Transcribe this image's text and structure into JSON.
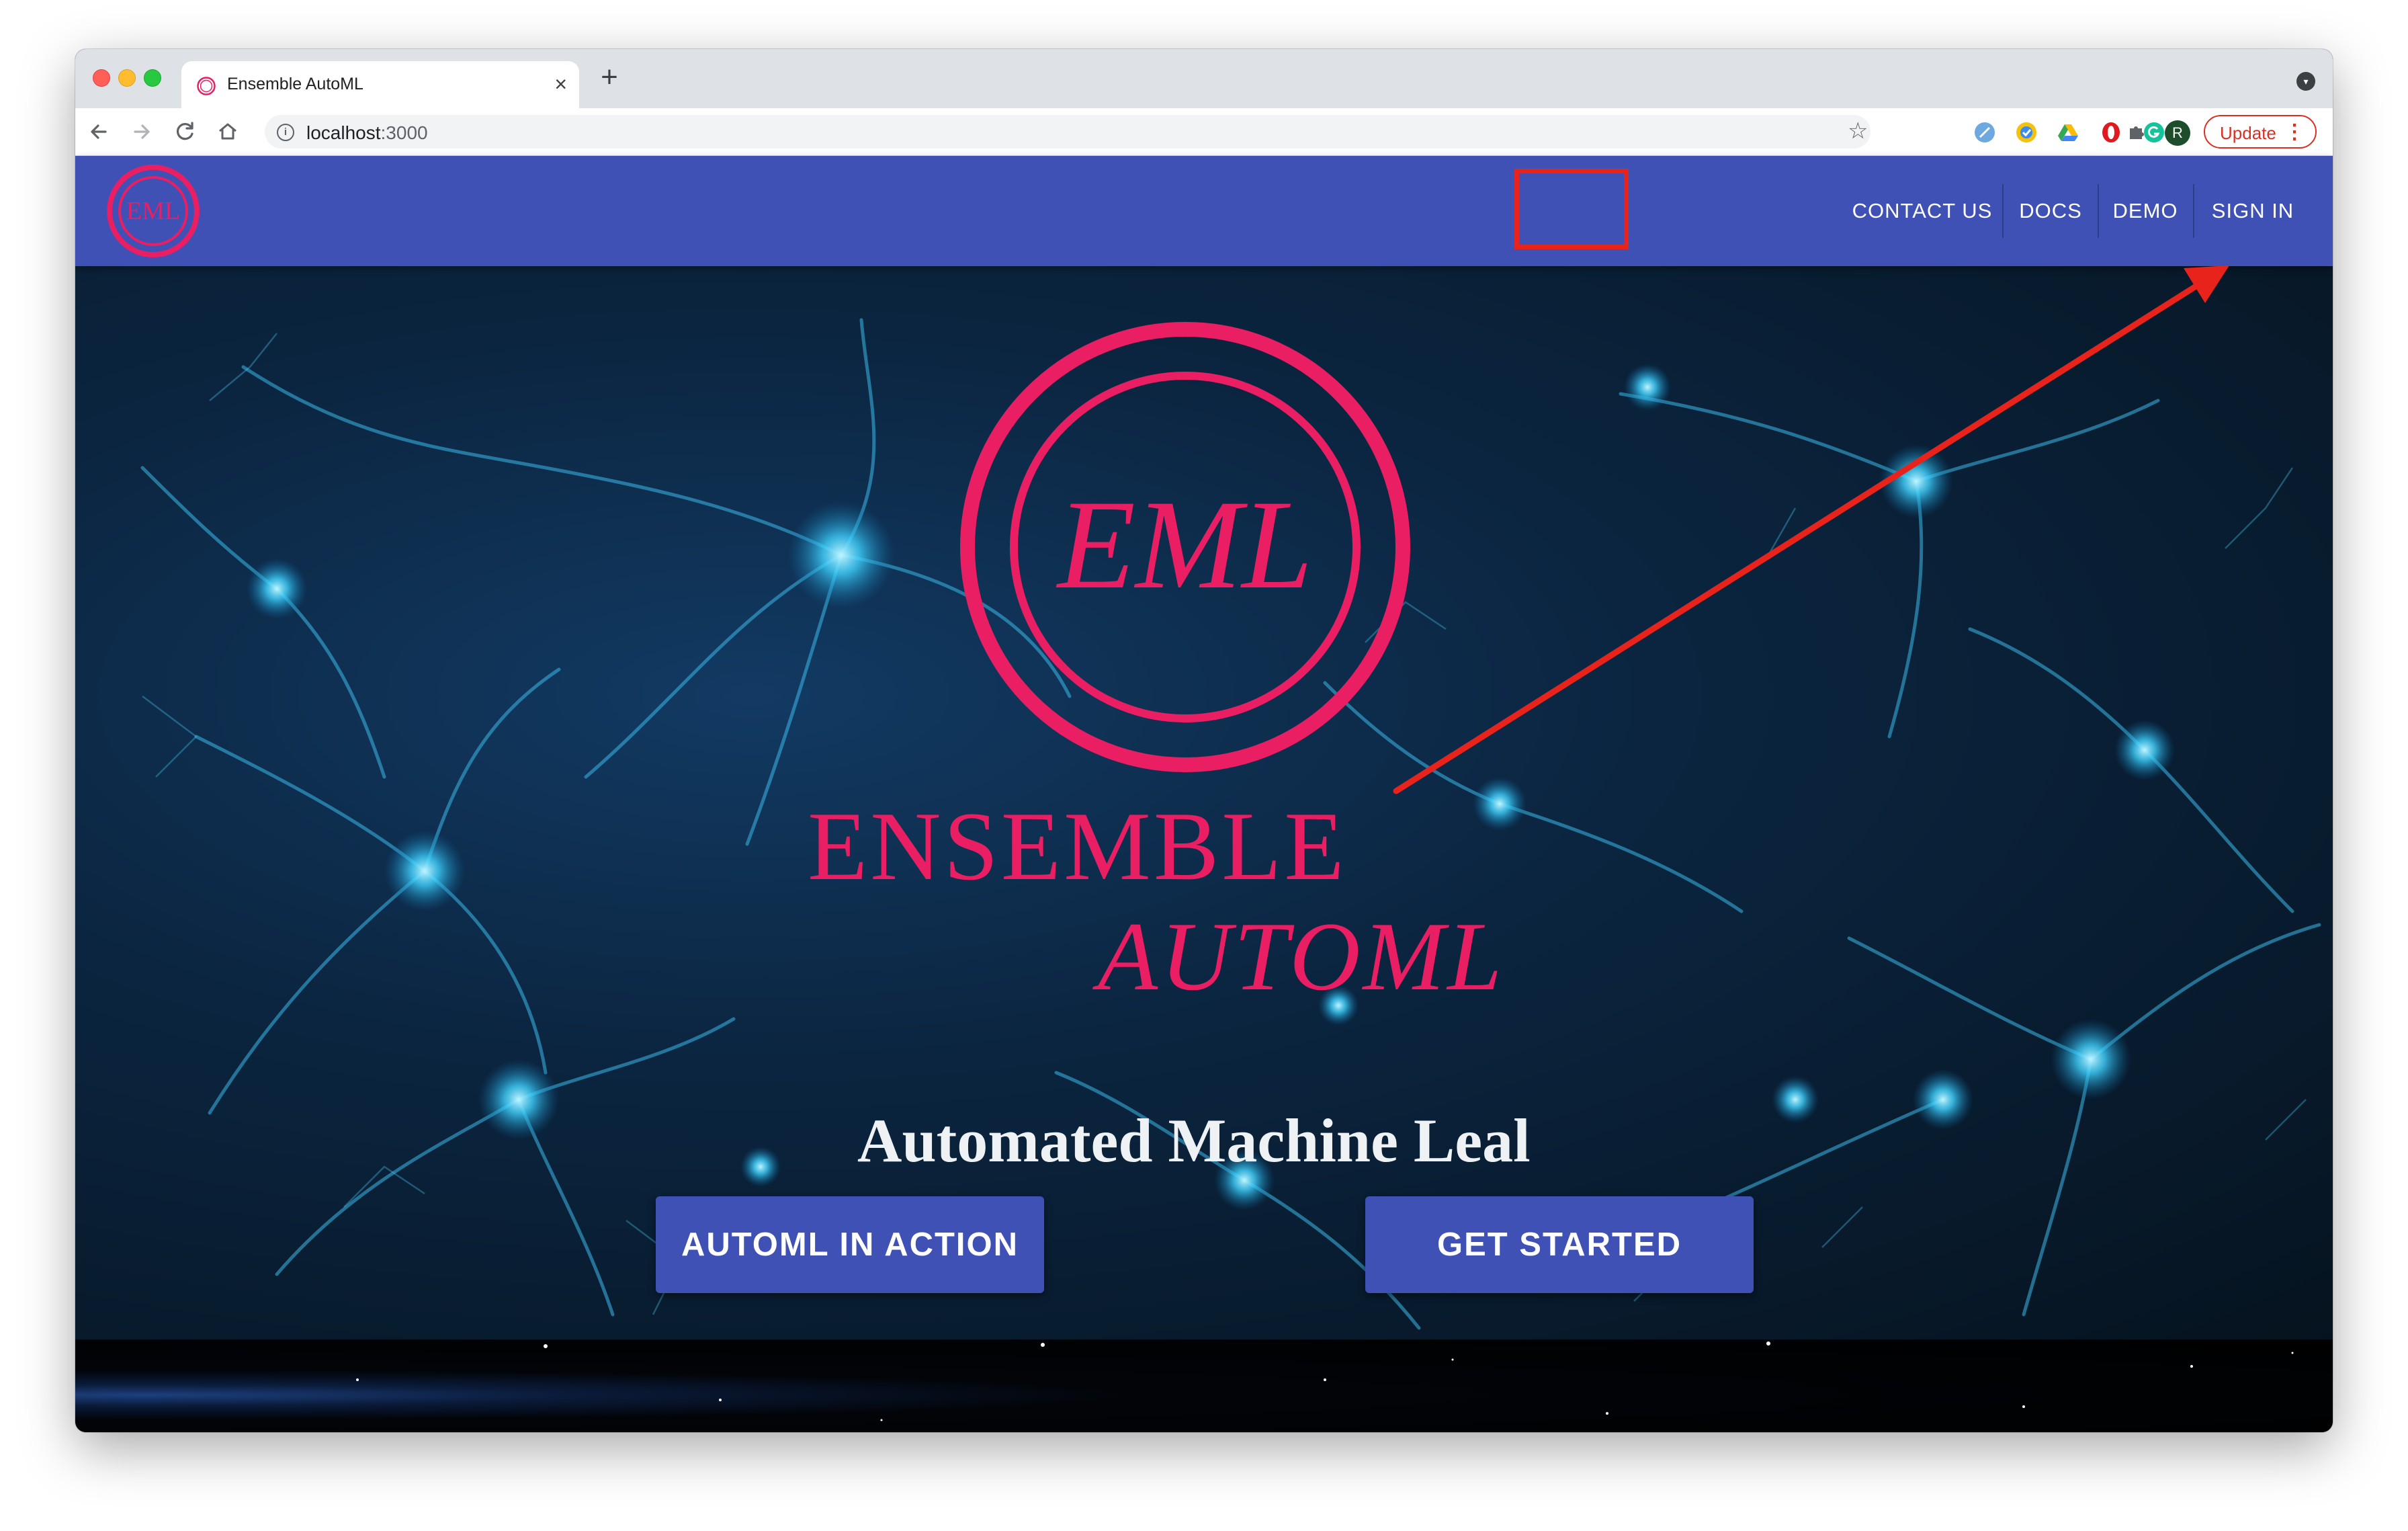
{
  "browser": {
    "tab_title": "Ensemble AutoML",
    "tab_close": "×",
    "new_tab": "+",
    "url_host": "localhost",
    "url_port": ":3000",
    "profile_initial": "R",
    "update_label": "Update",
    "update_menu": "⋮",
    "icons": [
      "back-icon",
      "forward-icon",
      "reload-icon",
      "home-icon",
      "info-icon",
      "star-icon",
      "extensions-icon"
    ]
  },
  "app": {
    "nav": [
      "CONTACT US",
      "DOCS",
      "DEMO",
      "SIGN IN"
    ],
    "logo_text": "EML",
    "title_line1": "ENSEMBLE",
    "title_line2": "AUTOML",
    "tagline": "Automated Machine Leal",
    "buttons": [
      "AUTOML IN ACTION",
      "GET STARTED"
    ]
  },
  "colors": {
    "appbar": "#3f51b5",
    "accent": "#e91e63",
    "annotation": "#e8231b",
    "update": "#d93025"
  }
}
